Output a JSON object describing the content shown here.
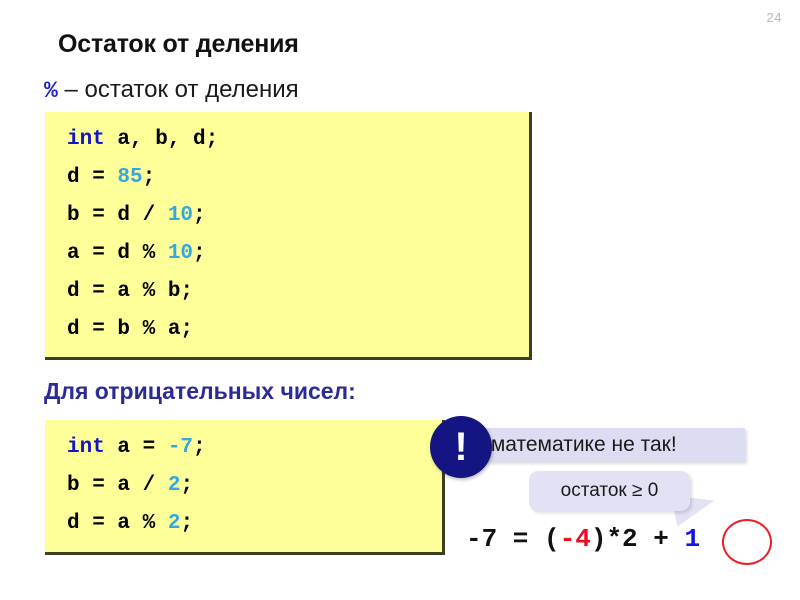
{
  "slide": {
    "number": "24",
    "title": "Остаток от деления",
    "subtitle": {
      "operator": "%",
      "text": " – остаток от деления"
    },
    "section_heading": "Для отрицательных чисел:"
  },
  "code_block_1": {
    "lines": [
      {
        "kw": "int",
        "rest": " a, b, d;"
      },
      {
        "plain": "d = ",
        "num": "85",
        "tail": ";"
      },
      {
        "plain": "b = d / ",
        "num": "10",
        "tail": ";"
      },
      {
        "plain": "a = d % ",
        "num": "10",
        "tail": ";"
      },
      {
        "plain": "d = a % b;",
        "num": "",
        "tail": ""
      },
      {
        "plain": "d = b % a;",
        "num": "",
        "tail": ""
      }
    ],
    "line1_kw": "int",
    "line1_rest": " a, b, d;",
    "line2_plain": "d = ",
    "line2_num": "85",
    "line2_tail": ";",
    "line3_plain": "b = d / ",
    "line3_num": "10",
    "line3_tail": ";",
    "line4_plain": "a = d % ",
    "line4_num": "10",
    "line4_tail": ";",
    "line5_plain": "d = a % b;",
    "line6_plain": "d = b % a;"
  },
  "code_block_2": {
    "line1_kw": "int",
    "line1_mid": " a = ",
    "line1_num": "-7",
    "line1_tail": ";",
    "line2_plain": "b = a / ",
    "line2_num": "2",
    "line2_tail": ";",
    "line3_plain": "d = a % ",
    "line3_num": "2",
    "line3_tail": ";"
  },
  "callouts": {
    "badge_glyph": "!",
    "banner_text": "В математике не так!",
    "bubble_text": "остаток ≥ 0"
  },
  "equation": {
    "lhs": "-7 = (",
    "negative": "-4",
    "mid": ")*2 + ",
    "remainder": "1"
  },
  "colors": {
    "code_background": "#ffff99",
    "keyword": "#1414c8",
    "number": "#33a8e0",
    "navy_heading": "#2b2b96",
    "badge": "#141482",
    "banner": "#dcdcf2",
    "bubble": "#e2e2f4",
    "negative_red": "#ee0d20",
    "remainder_blue": "#1414e6",
    "circle_red": "#ee1d25"
  }
}
